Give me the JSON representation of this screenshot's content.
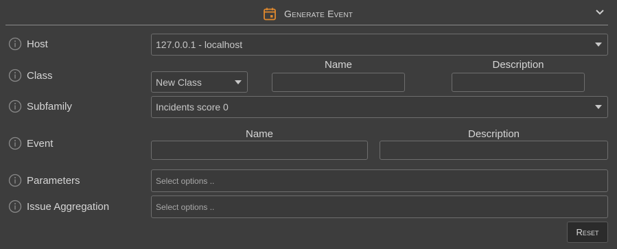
{
  "header": {
    "title": "Generate Event"
  },
  "rows": {
    "host": {
      "label": "Host",
      "value": "127.0.0.1 - localhost"
    },
    "class": {
      "label": "Class",
      "select_value": "New Class",
      "name_header": "Name",
      "description_header": "Description"
    },
    "subfamily": {
      "label": "Subfamily",
      "value": "Incidents score 0"
    },
    "event": {
      "label": "Event",
      "name_header": "Name",
      "description_header": "Description"
    },
    "parameters": {
      "label": "Parameters",
      "placeholder": "Select options .."
    },
    "issue_aggregation": {
      "label": "Issue Aggregation",
      "placeholder": "Select options .."
    }
  },
  "reset_label": "Reset",
  "colors": {
    "accent": "#e0892e",
    "background": "#3d3d3d",
    "field_border": "#6e6e6e"
  },
  "icons": [
    "calendar-icon",
    "chevron-down-icon",
    "info-icon",
    "dropdown-caret-icon"
  ]
}
